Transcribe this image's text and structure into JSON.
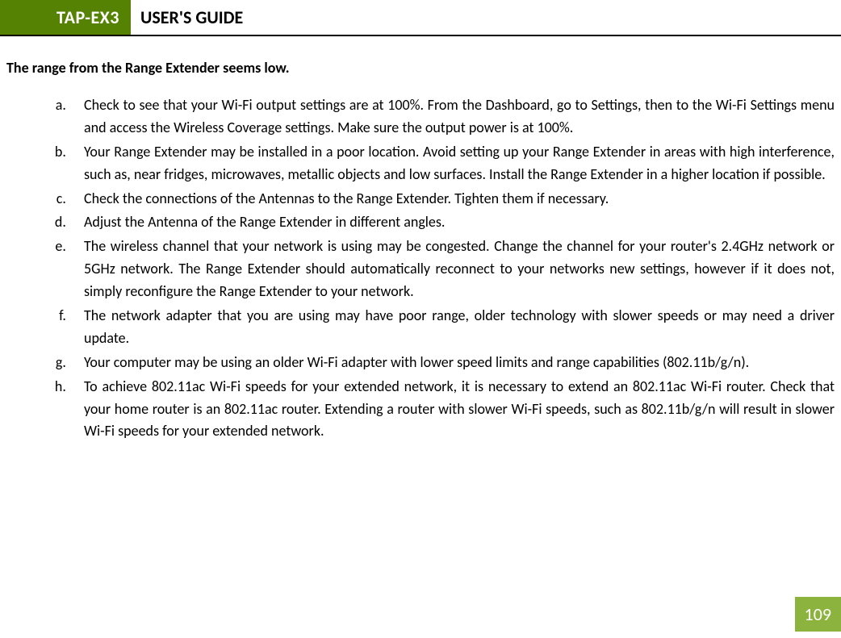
{
  "header": {
    "badge": "TAP-EX3",
    "title": "USER'S GUIDE"
  },
  "section": {
    "title": "The range from the Range Extender seems low."
  },
  "items": [
    "Check to see that your Wi-Fi output settings are at 100%. From the Dashboard, go to Settings, then to the Wi-Fi Settings menu and access the Wireless Coverage settings.  Make sure the output power is at 100%.",
    "Your Range Extender may be installed in a poor location. Avoid setting up your Range Extender in areas with high interference, such as, near fridges, microwaves, metallic objects and low surfaces. Install the Range Extender in a higher location if possible.",
    "Check the connections of the Antennas to the Range Extender. Tighten them if necessary.",
    "Adjust the Antenna of the Range Extender in different angles.",
    "The wireless channel that your network is using may be congested. Change the channel for your router's 2.4GHz network or 5GHz network. The Range Extender should automatically reconnect to your networks new settings, however if it does not, simply reconfigure the Range Extender to your network.",
    "The network adapter that you are using may have poor range, older technology with slower speeds or may need a driver update.",
    "Your computer may be using an older Wi-Fi adapter with lower speed limits and range capabilities (802.11b/g/n).",
    "To achieve 802.11ac Wi-Fi speeds for your extended network, it is necessary to extend an 802.11ac Wi-Fi router.  Check that your home router is an 802.11ac router.  Extending a router with slower Wi-Fi speeds, such as 802.11b/g/n will result in slower Wi-Fi speeds for your extended network."
  ],
  "page_number": "109"
}
